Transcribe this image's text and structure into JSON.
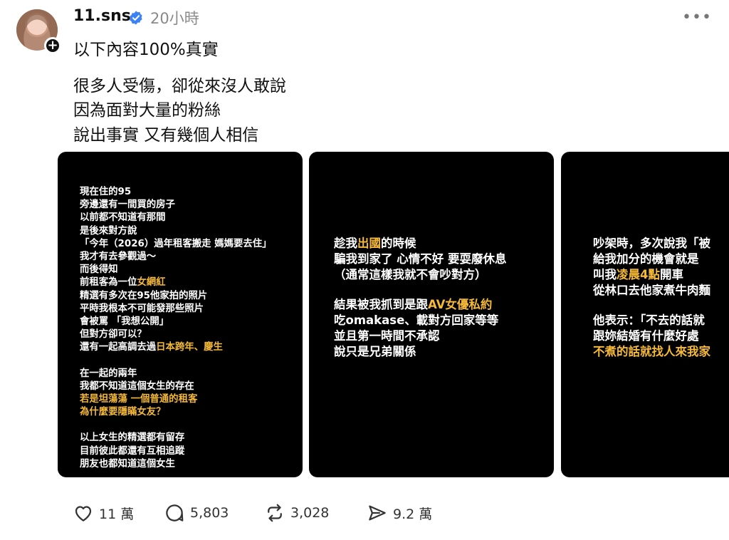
{
  "post": {
    "username": "11.sns",
    "time": "20小時",
    "more": "•••",
    "avatar_plus": "+",
    "lines": [
      "以下內容100%真實",
      "很多人受傷，卻從來沒人敢說",
      "因為面對大量的粉絲",
      "說出事實 又有幾個人相信"
    ]
  },
  "cards": [
    {
      "rows": [
        [
          {
            "t": "現在住的95"
          }
        ],
        [
          {
            "t": "旁邊還有一間買的房子"
          }
        ],
        [
          {
            "t": "以前都不知道有那間"
          }
        ],
        [
          {
            "t": "是後來對方說"
          }
        ],
        [
          {
            "t": "「今年（2026）過年租客搬走 媽媽要去住」"
          }
        ],
        [
          {
            "t": "我才有去參觀過～"
          }
        ],
        [
          {
            "t": "而後得知"
          }
        ],
        [
          {
            "t": "前租客為一位"
          },
          {
            "t": "女網紅",
            "h": true
          }
        ],
        [
          {
            "t": "精選有多次在95他家拍的照片"
          }
        ],
        [
          {
            "t": "平時我根本不可能發那些照片"
          }
        ],
        [
          {
            "t": "會被罵 「我想公開」"
          }
        ],
        [
          {
            "t": "但對方卻可以？"
          }
        ],
        [
          {
            "t": "還有一起高調去過"
          },
          {
            "t": "日本跨年、慶生",
            "h": true
          }
        ],
        [],
        [
          {
            "t": "在一起的兩年"
          }
        ],
        [
          {
            "t": "我都不知道這個女生的存在"
          }
        ],
        [
          {
            "t": "若是坦蕩蕩 一個普通的租客",
            "h": true
          }
        ],
        [
          {
            "t": "為什麼要隱瞞女友？",
            "h": true
          }
        ],
        [],
        [
          {
            "t": "以上女生的精選都有留存"
          }
        ],
        [
          {
            "t": "目前彼此都還有互相追蹤"
          }
        ],
        [
          {
            "t": "朋友也都知道這個女生"
          }
        ]
      ]
    },
    {
      "rows": [
        [
          {
            "t": "趁我"
          },
          {
            "t": "出國",
            "h": true
          },
          {
            "t": "的時候"
          }
        ],
        [
          {
            "t": "騙我到家了 心情不好 要耍廢休息"
          }
        ],
        [
          {
            "t": "（通常這樣我就不會吵對方）"
          }
        ],
        [],
        [
          {
            "t": "結果被我抓到是跟"
          },
          {
            "t": "AV女優私約",
            "h": true
          }
        ],
        [
          {
            "t": "吃omakase、載對方回家等等"
          }
        ],
        [
          {
            "t": "並且第一時間不承認"
          }
        ],
        [
          {
            "t": "說只是兄弟關係"
          }
        ]
      ]
    },
    {
      "rows": [
        [
          {
            "t": "吵架時，多次說我「被"
          }
        ],
        [
          {
            "t": "給我加分的機會就是"
          }
        ],
        [
          {
            "t": "叫我"
          },
          {
            "t": "凌晨4點",
            "h": true
          },
          {
            "t": "開車"
          }
        ],
        [
          {
            "t": "從林口去他家煮牛肉麵"
          }
        ],
        [],
        [
          {
            "t": "他表示：「不去的話就"
          }
        ],
        [
          {
            "t": "跟妳結婚有什麼好處"
          }
        ],
        [
          {
            "t": "不煮的話就找人來我家",
            "h": true
          }
        ]
      ]
    }
  ],
  "actions": {
    "likes": "11 萬",
    "comments": "5,803",
    "reposts": "3,028",
    "shares": "9.2 萬"
  },
  "colors": {
    "highlight": "#f5b938",
    "verified": "#3b82f6"
  },
  "icons": [
    "heart-icon",
    "comment-icon",
    "repost-icon",
    "share-icon",
    "verified-icon",
    "more-icon"
  ]
}
